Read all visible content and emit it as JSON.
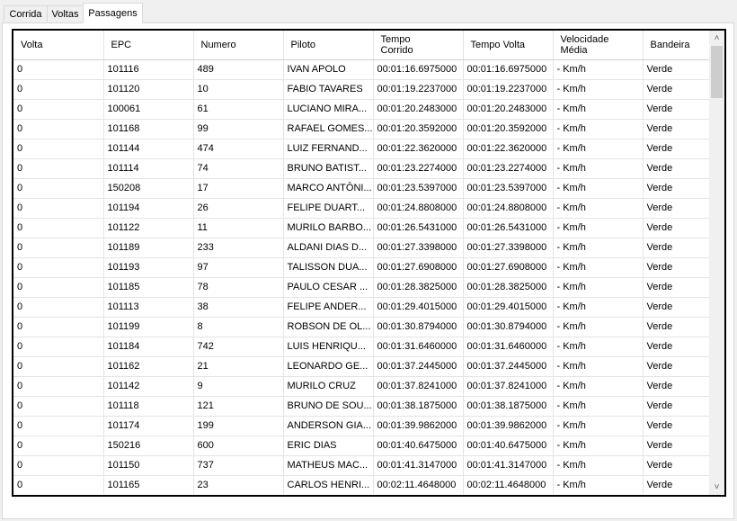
{
  "tabs": [
    {
      "label": "Corrida"
    },
    {
      "label": "Voltas"
    },
    {
      "label": "Passagens"
    }
  ],
  "active_tab": "Passagens",
  "grid": {
    "columns": [
      {
        "label": "Volta"
      },
      {
        "label": "EPC"
      },
      {
        "label": "Numero"
      },
      {
        "label": "Piloto"
      },
      {
        "label": "Tempo\nCorrido"
      },
      {
        "label": "Tempo Volta"
      },
      {
        "label": "Velocidade\nMédia"
      },
      {
        "label": "Bandeira"
      }
    ],
    "rows": [
      [
        "0",
        "101116",
        "489",
        "IVAN APOLO",
        "00:01:16.6975000",
        "00:01:16.6975000",
        "- Km/h",
        "Verde"
      ],
      [
        "0",
        "101120",
        "10",
        "FABIO TAVARES",
        "00:01:19.2237000",
        "00:01:19.2237000",
        "- Km/h",
        "Verde"
      ],
      [
        "0",
        "100061",
        "61",
        "LUCIANO MIRA...",
        "00:01:20.2483000",
        "00:01:20.2483000",
        "- Km/h",
        "Verde"
      ],
      [
        "0",
        "101168",
        "99",
        "RAFAEL GOMES...",
        "00:01:20.3592000",
        "00:01:20.3592000",
        "- Km/h",
        "Verde"
      ],
      [
        "0",
        "101144",
        "474",
        "LUIZ FERNAND...",
        "00:01:22.3620000",
        "00:01:22.3620000",
        "- Km/h",
        "Verde"
      ],
      [
        "0",
        "101114",
        "74",
        "BRUNO BATIST...",
        "00:01:23.2274000",
        "00:01:23.2274000",
        "- Km/h",
        "Verde"
      ],
      [
        "0",
        "150208",
        "17",
        "MARCO ANTÔNI...",
        "00:01:23.5397000",
        "00:01:23.5397000",
        "- Km/h",
        "Verde"
      ],
      [
        "0",
        "101194",
        "26",
        "FELIPE DUART...",
        "00:01:24.8808000",
        "00:01:24.8808000",
        "- Km/h",
        "Verde"
      ],
      [
        "0",
        "101122",
        "11",
        "MURILO BARBO...",
        "00:01:26.5431000",
        "00:01:26.5431000",
        "- Km/h",
        "Verde"
      ],
      [
        "0",
        "101189",
        "233",
        "ALDANI DIAS D...",
        "00:01:27.3398000",
        "00:01:27.3398000",
        "- Km/h",
        "Verde"
      ],
      [
        "0",
        "101193",
        "97",
        "TALISSON DUA...",
        "00:01:27.6908000",
        "00:01:27.6908000",
        "- Km/h",
        "Verde"
      ],
      [
        "0",
        "101185",
        "78",
        "PAULO CESAR ...",
        "00:01:28.3825000",
        "00:01:28.3825000",
        "- Km/h",
        "Verde"
      ],
      [
        "0",
        "101113",
        "38",
        "FELIPE ANDER...",
        "00:01:29.4015000",
        "00:01:29.4015000",
        "- Km/h",
        "Verde"
      ],
      [
        "0",
        "101199",
        "8",
        "ROBSON DE OL...",
        "00:01:30.8794000",
        "00:01:30.8794000",
        "- Km/h",
        "Verde"
      ],
      [
        "0",
        "101184",
        "742",
        "LUIS HENRIQU...",
        "00:01:31.6460000",
        "00:01:31.6460000",
        "- Km/h",
        "Verde"
      ],
      [
        "0",
        "101162",
        "21",
        "LEONARDO GE...",
        "00:01:37.2445000",
        "00:01:37.2445000",
        "- Km/h",
        "Verde"
      ],
      [
        "0",
        "101142",
        "9",
        "MURILO CRUZ",
        "00:01:37.8241000",
        "00:01:37.8241000",
        "- Km/h",
        "Verde"
      ],
      [
        "0",
        "101118",
        "121",
        "BRUNO DE SOU...",
        "00:01:38.1875000",
        "00:01:38.1875000",
        "- Km/h",
        "Verde"
      ],
      [
        "0",
        "101174",
        "199",
        "ANDERSON GIA...",
        "00:01:39.9862000",
        "00:01:39.9862000",
        "- Km/h",
        "Verde"
      ],
      [
        "0",
        "150216",
        "600",
        "ERIC DIAS",
        "00:01:40.6475000",
        "00:01:40.6475000",
        "- Km/h",
        "Verde"
      ],
      [
        "0",
        "101150",
        "737",
        "MATHEUS MAC...",
        "00:01:41.3147000",
        "00:01:41.3147000",
        "- Km/h",
        "Verde"
      ],
      [
        "0",
        "101165",
        "23",
        "CARLOS HENRI...",
        "00:02:11.4648000",
        "00:02:11.4648000",
        "- Km/h",
        "Verde"
      ]
    ]
  },
  "icons": {
    "scroll_up": "chevron-up-icon",
    "scroll_down": "chevron-down-icon",
    "scroll_left": "chevron-left-icon",
    "scroll_right": "chevron-right-icon"
  },
  "glyphs": {
    "up": "˄",
    "down": "˅",
    "left": "˂",
    "right": "˃"
  }
}
